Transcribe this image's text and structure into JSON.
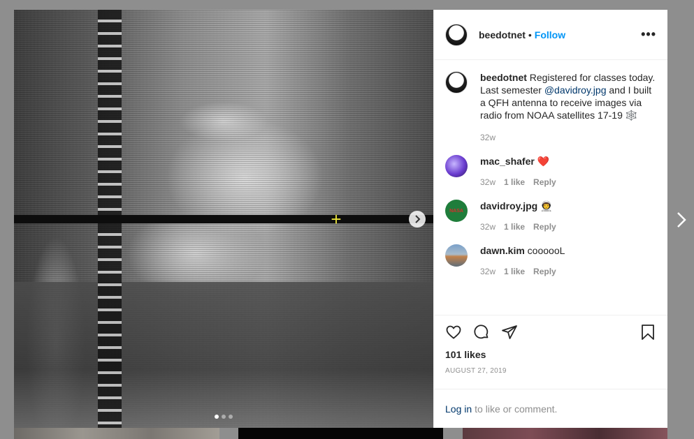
{
  "post": {
    "username": "beedotnet",
    "separator": "•",
    "follow_label": "Follow",
    "more_label": "•••"
  },
  "caption": {
    "username": "beedotnet",
    "text_before": " Registered for classes today. Last semester ",
    "mention": "@davidroy.jpg",
    "text_after": " and I built a QFH antenna to receive images via radio from NOAA satellites 17-19 ",
    "emoji": "🕸️",
    "time": "32w"
  },
  "comments": [
    {
      "username": "mac_shafer",
      "text": " ❤️",
      "time": "32w",
      "likes": "1 like",
      "reply": "Reply"
    },
    {
      "username": "davidroy.jpg",
      "text": " 👨‍🚀",
      "time": "32w",
      "likes": "1 like",
      "reply": "Reply"
    },
    {
      "username": "dawn.kim",
      "text": " coooooL",
      "time": "32w",
      "likes": "1 like",
      "reply": "Reply"
    }
  ],
  "avatars": {
    "nasa_text": "NASA"
  },
  "engagement": {
    "likes": "101 likes",
    "date": "AUGUST 27, 2019"
  },
  "login": {
    "link": "Log in",
    "text": "to like or comment."
  },
  "carousel": {
    "slide_count": 3,
    "active_slide": 1
  },
  "colors": {
    "accent": "#0095f6",
    "link": "#00376b",
    "muted": "#8e8e8e",
    "crosshair": "#e8e23a"
  },
  "icons": [
    "heart-icon",
    "comment-icon",
    "share-icon",
    "bookmark-icon",
    "chevron-right-icon",
    "more-icon",
    "crosshair-icon"
  ]
}
